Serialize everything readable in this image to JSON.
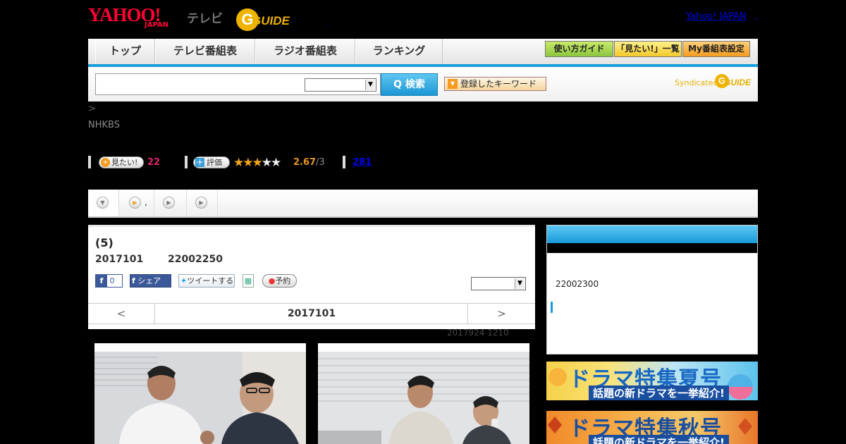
{
  "header": {
    "logo_yahoo": "YAHOO!",
    "logo_japan": "JAPAN",
    "logo_tv": "テレビ",
    "logo_gguide": "GUIDE",
    "logo_dot": ",",
    "yahoo_link": "Yahoo! JAPAN",
    "yahoo_link_sep": ","
  },
  "nav": {
    "tabs": [
      "トップ",
      "テレビ番組表",
      "ラジオ番組表",
      "ランキング"
    ],
    "buttons": [
      "使い方ガイド",
      "「見たい!」一覧",
      "My番組表設定"
    ],
    "accent": "#16a0dc"
  },
  "search": {
    "button_label": "Q 検索",
    "keyword_button": "登録したキーワード",
    "syndicated": "Syndicated",
    "syndicated_logo": "GUIDE"
  },
  "breadcrumb": ">",
  "station": "NHKBS",
  "stats": {
    "want_label": "見たい!",
    "want_count": "22",
    "rate_label": "評価",
    "rating": "2.67",
    "rating_max": "/3",
    "rating_value": 2.67,
    "stars_total": 5,
    "reviews": "281"
  },
  "subtabs": [
    ",",
    "",
    "",
    ""
  ],
  "program": {
    "title": "(5)",
    "date": "2017101",
    "time": "22002250",
    "fb_count": "0",
    "fb_share": "シェア",
    "tweet": "ツイートする",
    "reserve": "予約",
    "pager_prev": "<",
    "pager_date": "2017101",
    "pager_next": ">"
  },
  "updated": "2017924  1210",
  "sidebar": {
    "time": "22002300"
  },
  "banners": [
    {
      "title": "ドラマ特集夏号",
      "sub": "話題の新ドラマを一挙紹介!"
    },
    {
      "title": "ドラマ特集秋号",
      "sub": "話題の新ドラマを一挙紹介!"
    }
  ]
}
